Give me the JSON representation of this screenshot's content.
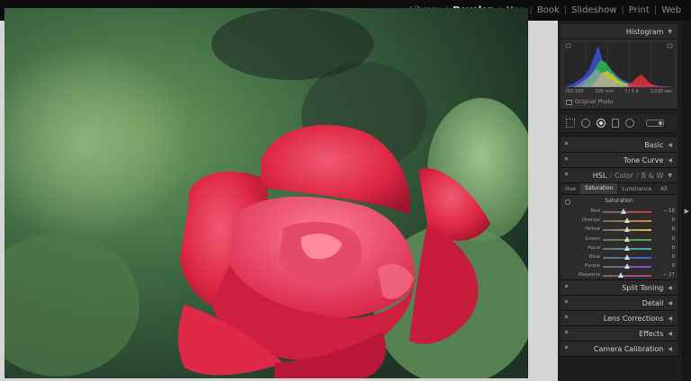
{
  "modules": [
    "Library",
    "Develop",
    "Map",
    "Book",
    "Slideshow",
    "Print",
    "Web"
  ],
  "active_module": "Develop",
  "panel": {
    "histogram_title": "Histogram",
    "exif": [
      "ISO 500",
      "105 mm",
      "f / 5.6",
      "1/200 sec"
    ],
    "original_photo": "Original Photo",
    "basic": "Basic",
    "tone_curve": "Tone Curve",
    "hsl": {
      "hsl": "HSL",
      "color": "Color",
      "bw": "B & W"
    },
    "hsl_tabs": [
      "Hue",
      "Saturation",
      "Luminance",
      "All"
    ],
    "hsl_active_tab": "Saturation",
    "saturation_title": "Saturation",
    "saturation": [
      {
        "label": "Red",
        "value": "− 16",
        "color": "#d23a3a"
      },
      {
        "label": "Orange",
        "value": "0",
        "color": "#e08a2c"
      },
      {
        "label": "Yellow",
        "value": "0",
        "color": "#d8c83a"
      },
      {
        "label": "Green",
        "value": "0",
        "color": "#4fb04a"
      },
      {
        "label": "Aqua",
        "value": "0",
        "color": "#3cb8b0"
      },
      {
        "label": "Blue",
        "value": "0",
        "color": "#3a62cf"
      },
      {
        "label": "Purple",
        "value": "0",
        "color": "#8a4ac8"
      },
      {
        "label": "Magenta",
        "value": "− 27",
        "color": "#c83a9a"
      }
    ],
    "split_toning": "Split Toning",
    "detail": "Detail",
    "lens_corrections": "Lens Corrections",
    "effects": "Effects",
    "camera_calibration": "Camera Calibration"
  }
}
